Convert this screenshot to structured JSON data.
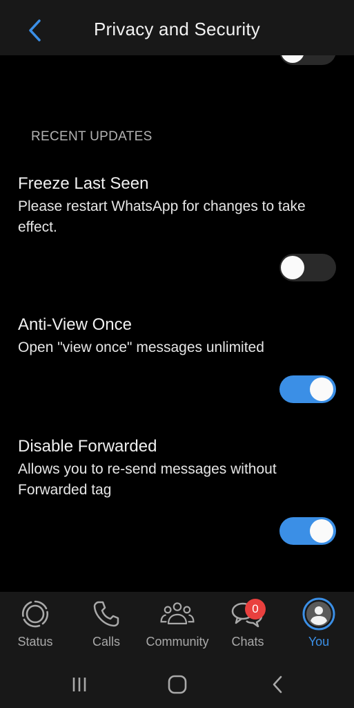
{
  "appbar": {
    "title": "Privacy and Security",
    "back_icon": "chevron-left-icon"
  },
  "content": {
    "partial_toggle": {
      "state": "off"
    },
    "section_header": "RECENT UPDATES",
    "settings": [
      {
        "title": "Freeze Last Seen",
        "description": "Please restart WhatsApp for changes to take effect.",
        "enabled": false
      },
      {
        "title": "Anti-View Once",
        "description": "Open \"view once\" messages unlimited",
        "enabled": true
      },
      {
        "title": "Disable Forwarded",
        "description": "Allows you to re-send messages without Forwarded tag",
        "enabled": true
      }
    ]
  },
  "bottom_nav": {
    "items": [
      {
        "label": "Status",
        "icon": "status-icon",
        "active": false
      },
      {
        "label": "Calls",
        "icon": "phone-icon",
        "active": false
      },
      {
        "label": "Community",
        "icon": "community-icon",
        "active": false
      },
      {
        "label": "Chats",
        "icon": "chats-icon",
        "active": false,
        "badge": "0"
      },
      {
        "label": "You",
        "icon": "avatar-icon",
        "active": true
      }
    ]
  },
  "system_nav": {
    "recents": "recents-icon",
    "home": "home-icon",
    "back": "back-icon"
  },
  "colors": {
    "accent": "#3b8fe6",
    "badge": "#e9403e",
    "bar_background": "#181818",
    "page_background": "#000000"
  }
}
